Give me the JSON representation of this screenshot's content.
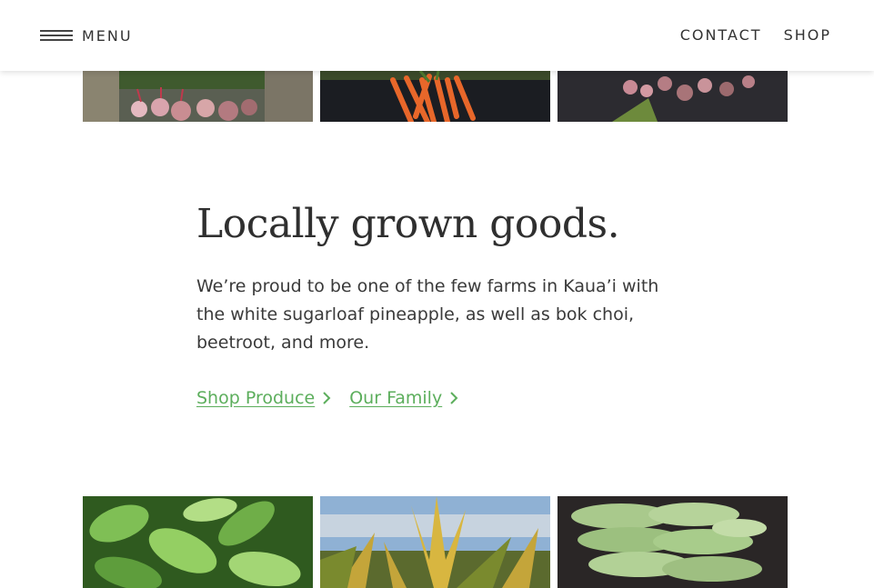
{
  "header": {
    "menu_label": "MENU",
    "nav": [
      {
        "label": "CONTACT"
      },
      {
        "label": "SHOP"
      }
    ]
  },
  "main": {
    "headline": "Locally grown goods.",
    "body": "We’re proud to be one of the few farms in Kaua’i with the white sugarloaf pineapple, as well as bok choi, beetroot, and more.",
    "links": [
      {
        "label": "Shop Produce",
        "icon": "chevron-right-icon"
      },
      {
        "label": "Our Family",
        "icon": "chevron-right-icon"
      }
    ]
  },
  "colors": {
    "link_green": "#5cae5c",
    "text": "#333333",
    "background": "#ffffff"
  }
}
